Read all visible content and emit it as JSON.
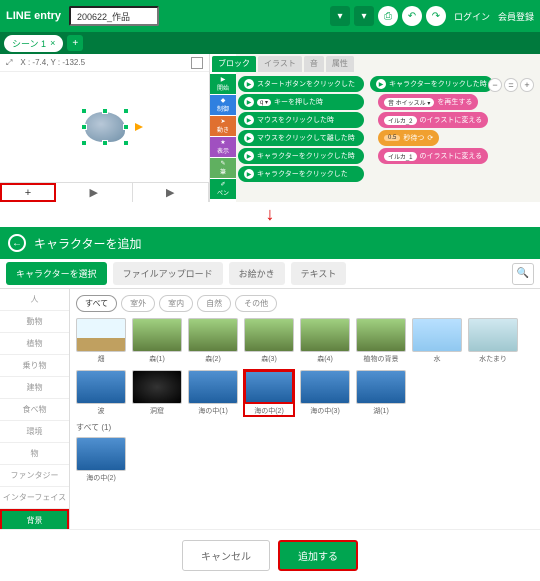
{
  "header": {
    "logo": "LINE entry",
    "filename": "200622_作品",
    "login": "ログイン",
    "register": "会員登録"
  },
  "scene": {
    "tab": "シーン 1",
    "close": "×",
    "add": "+"
  },
  "stage": {
    "coords": "X : -7.4, Y : -132.5",
    "play": "▶",
    "add": "+"
  },
  "blockTabs": {
    "block": "ブロック",
    "illust": "イラスト",
    "sound": "音",
    "attr": "属性"
  },
  "cats": [
    "開始",
    "制御",
    "動き",
    "表示",
    "筆",
    "ペン"
  ],
  "blocks": [
    "スタートボタンをクリックした",
    "キーを押した時",
    "マウスをクリックした時",
    "マウスをクリックして離した時",
    "キャラクターをクリックした時",
    "キャラクターをクリックした"
  ],
  "blockKey": "q ▾",
  "canvas": {
    "title": "キャラクターをクリックした時",
    "b1": {
      "chip": "音 ホイッスル ▾",
      "text": "を再生する"
    },
    "b2": {
      "chip": "イルカ_2",
      "text": "のイラストに変える"
    },
    "b3": {
      "chip": "0.5",
      "text": "秒待つ"
    },
    "b4": {
      "chip": "イルカ_1",
      "text": "のイラストに変える"
    },
    "zoom": {
      "minus": "−",
      "eq": "=",
      "plus": "+"
    }
  },
  "modal": {
    "title": "キャラクターを追加",
    "back": "←"
  },
  "mtabs": {
    "select": "キャラクターを選択",
    "upload": "ファイルアップロード",
    "draw": "お絵かき",
    "text": "テキスト"
  },
  "sidebar": [
    "人",
    "動物",
    "植物",
    "乗り物",
    "建物",
    "食べ物",
    "環境",
    "物",
    "ファンタジー",
    "インターフェイス",
    "背景"
  ],
  "filters": {
    "all": "すべて",
    "outdoor": "室外",
    "indoor": "室内",
    "nature": "自然",
    "other": "その他"
  },
  "cards": {
    "r1": [
      "畑",
      "森(1)",
      "森(2)",
      "森(3)",
      "森(4)",
      "植物の背景",
      "水"
    ],
    "r2": [
      "水たまり",
      "波",
      "洞窟",
      "海の中(1)",
      "海の中(2)",
      "海の中(3)",
      "湖(1)"
    ]
  },
  "selected": {
    "label": "すべて (1)",
    "item": "海の中(2)"
  },
  "actions": {
    "cancel": "キャンセル",
    "add": "追加する"
  }
}
